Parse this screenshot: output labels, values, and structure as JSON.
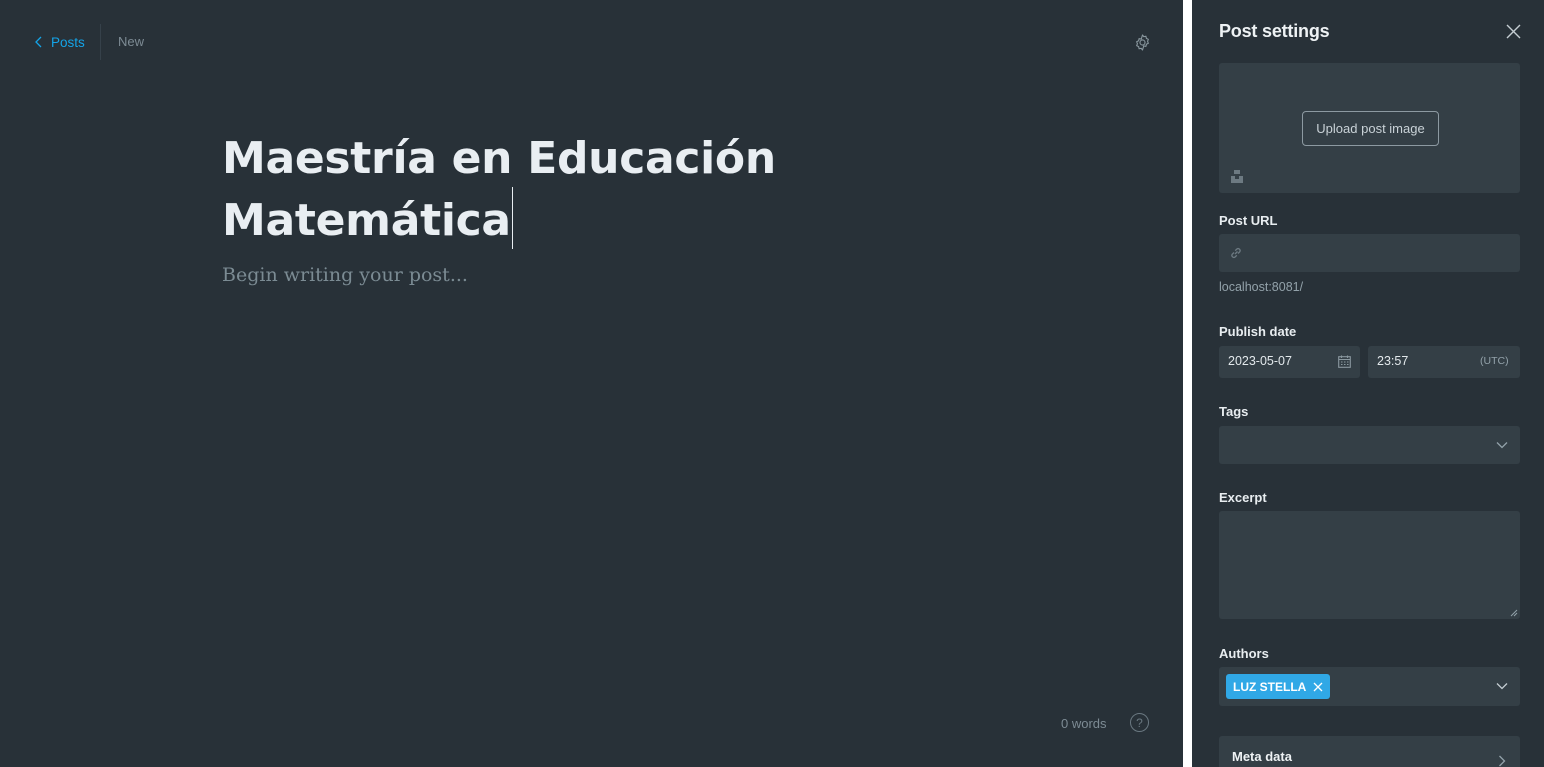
{
  "editor": {
    "back_label": "Posts",
    "status": "New",
    "title": "Maestría en Educación Matemática",
    "body_placeholder": "Begin writing your post...",
    "word_count": "0 words",
    "help_symbol": "?"
  },
  "settings": {
    "title": "Post settings",
    "upload_image_label": "Upload post image",
    "post_url": {
      "label": "Post URL",
      "value": "",
      "hint": "localhost:8081/"
    },
    "publish_date": {
      "label": "Publish date",
      "date": "2023-05-07",
      "time": "23:57",
      "timezone": "(UTC)"
    },
    "tags": {
      "label": "Tags",
      "value": ""
    },
    "excerpt": {
      "label": "Excerpt",
      "value": ""
    },
    "authors": {
      "label": "Authors",
      "selected": [
        "LUZ STELLA"
      ]
    },
    "meta_data_label": "Meta data"
  },
  "colors": {
    "background": "#283138",
    "input_background": "#343f46",
    "accent": "#14a4e8",
    "author_pill": "#30a8e6"
  }
}
